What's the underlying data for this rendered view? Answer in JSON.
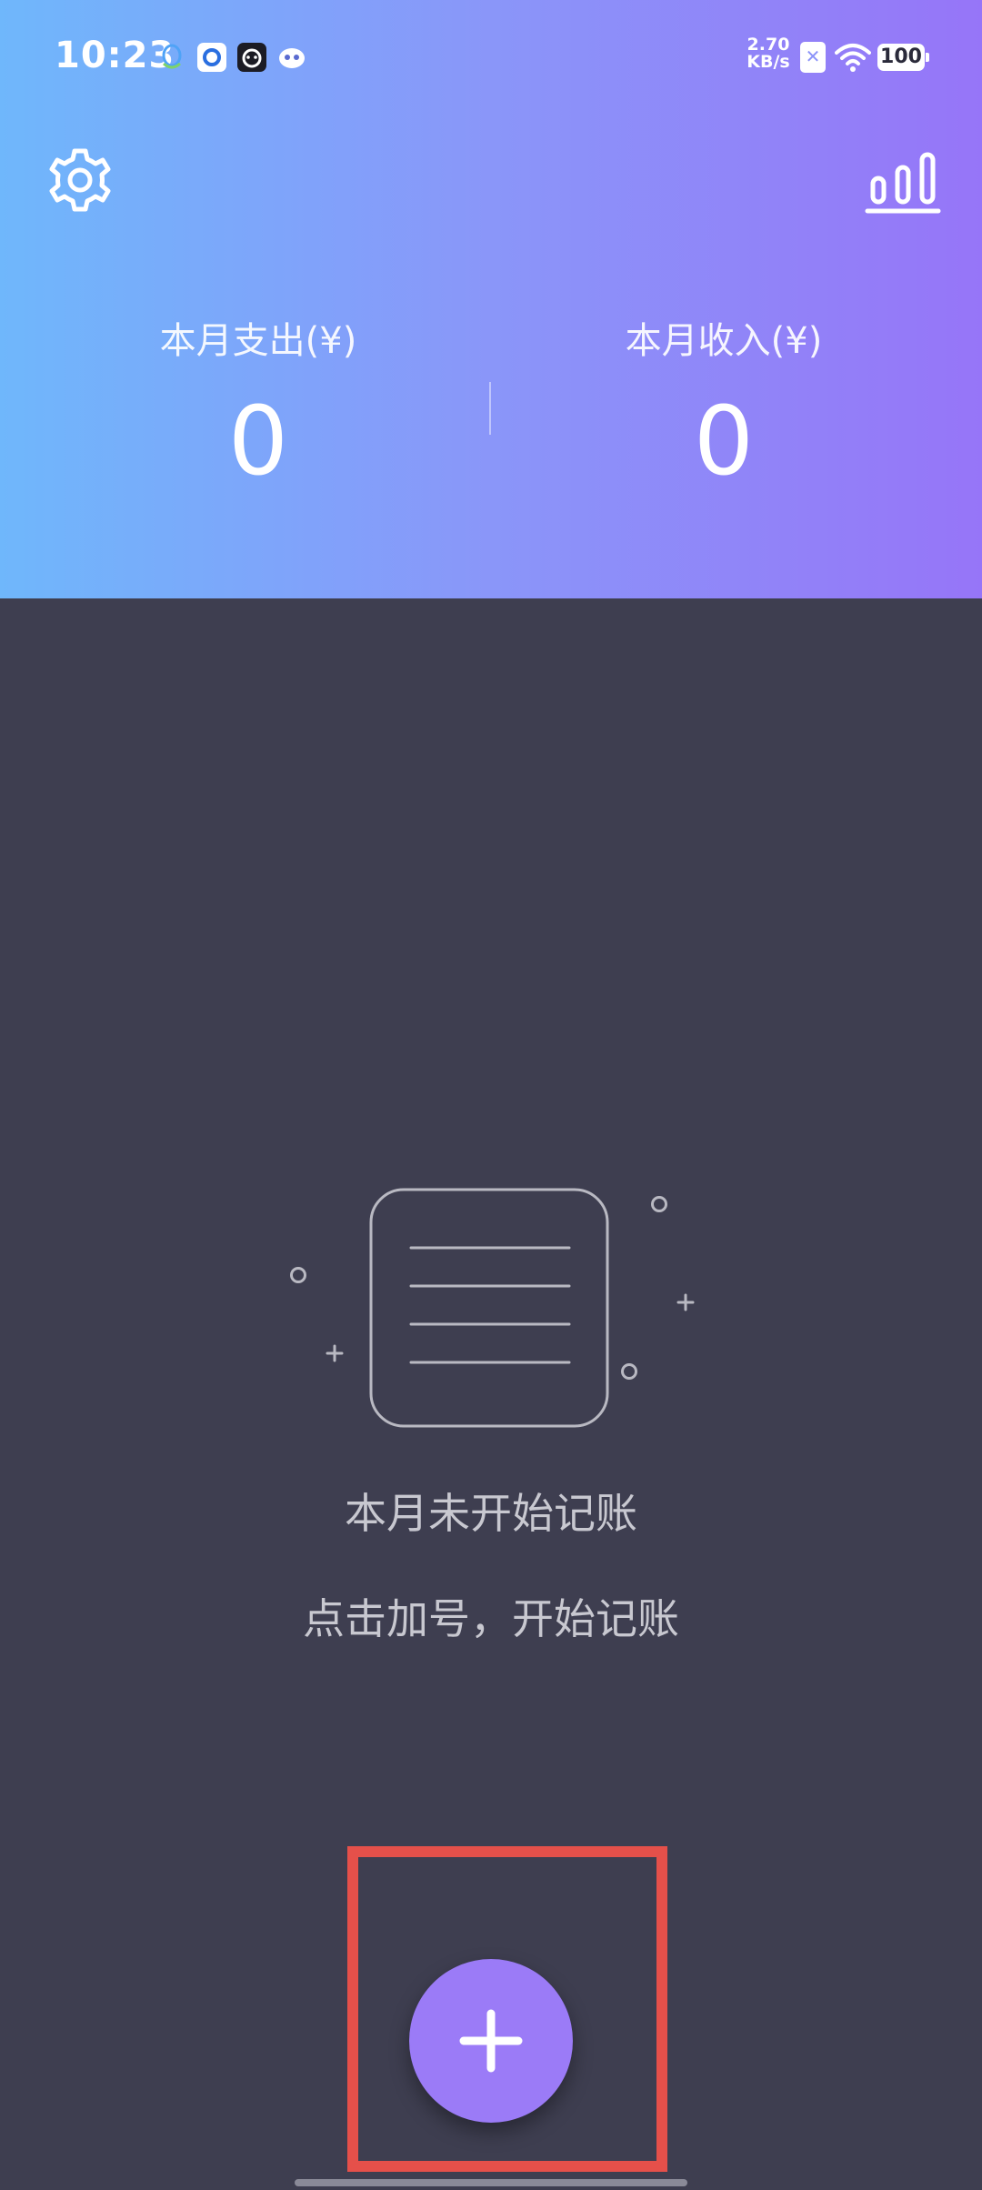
{
  "status_bar": {
    "time": "10:23",
    "net_speed_value": "2.70",
    "net_speed_unit": "KB/s",
    "battery": "100",
    "sim_glyph": "✕",
    "notification_icons": [
      "qq-icon",
      "app-icon",
      "app-icon",
      "app-icon"
    ]
  },
  "header": {
    "settings_icon": "gear-icon",
    "stats_icon": "bar-chart-icon",
    "expense_label": "本月支出(¥)",
    "expense_value": "0",
    "income_label": "本月收入(¥)",
    "income_value": "0"
  },
  "empty_state": {
    "icon": "empty-ledger-icon",
    "title": "本月未开始记账",
    "hint": "点击加号，开始记账"
  },
  "fab": {
    "icon": "plus-icon"
  },
  "colors": {
    "header_gradient_start": "#6fb7fb",
    "header_gradient_end": "#9675f8",
    "background": "#3e3e50",
    "fab": "#9b7bf7",
    "highlight": "#e5504a"
  }
}
